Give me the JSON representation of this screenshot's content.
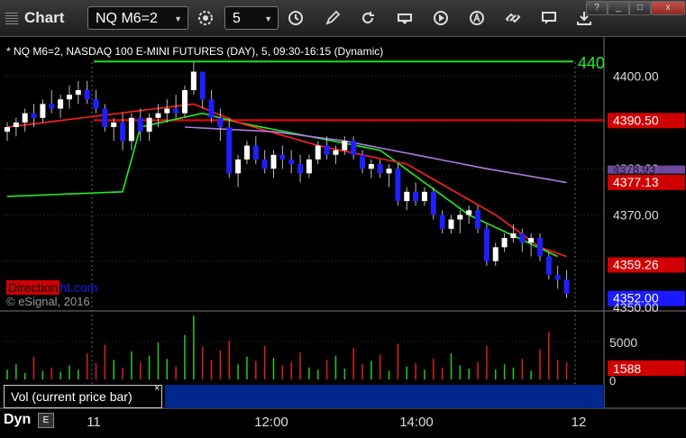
{
  "app": {
    "title": "Chart"
  },
  "toolbar": {
    "symbol": "NQ M6=2",
    "interval": "5",
    "icons": [
      "settings-icon",
      "clock-icon",
      "pencil-icon",
      "refresh-icon",
      "get-icon",
      "play-icon",
      "alert-icon",
      "link-icon",
      "chat-icon",
      "download-icon"
    ]
  },
  "window_buttons": [
    "?",
    "_",
    "□",
    "x"
  ],
  "header": {
    "subtitle": "* NQ M6=2, NASDAQ 100 E-MINI FUTURES (DAY), 5, 09:30-16:15 (Dynamic)"
  },
  "watermark": {
    "brand_red": "Direction",
    "brand_blue": "ht.com",
    "copyright": "© eSignal, 2016"
  },
  "volume_panel": {
    "label": "Vol (current price bar)",
    "close": "×"
  },
  "footer": {
    "dyn": "Dyn",
    "icon": "E"
  },
  "colors": {
    "up": "#ffffff",
    "down": "#1f1fff",
    "ma_green": "#22ee22",
    "ma_red": "#ff2020",
    "ma_purple": "#b07ae0",
    "level": "#ff0000",
    "hline_green": "#22dd22"
  },
  "chart_data": {
    "type": "candlestick",
    "price_axis": {
      "ticks": [
        "4400.00",
        "4390.50",
        "4380.00",
        "4377.13",
        "4370.00",
        "4359.26",
        "4352.00",
        "4350.00"
      ],
      "ylim": [
        4350,
        4405
      ]
    },
    "price_tags": [
      {
        "label": "4390.50",
        "color": "#d00000"
      },
      {
        "label": "4377.13",
        "color": "#d00000"
      },
      {
        "label": "4359.26",
        "color": "#d00000"
      },
      {
        "label": "4352.00",
        "color": "#1a1aff"
      },
      {
        "label": "4378.93",
        "color": "#7a50b0"
      }
    ],
    "partial_tag": "440",
    "levels": [
      4390.5,
      4403.2
    ],
    "volume_axis": {
      "ticks": [
        "5000",
        "0"
      ],
      "tag": "1588"
    },
    "x_labels": [
      "11",
      "12:00",
      "14:00",
      "12"
    ],
    "ohlc": [
      [
        4388,
        4390,
        4386,
        4389
      ],
      [
        4389,
        4391,
        4387,
        4390
      ],
      [
        4390,
        4393,
        4388,
        4392
      ],
      [
        4392,
        4394,
        4389,
        4391
      ],
      [
        4391,
        4395,
        4390,
        4394
      ],
      [
        4394,
        4397,
        4392,
        4393
      ],
      [
        4393,
        4396,
        4391,
        4395
      ],
      [
        4395,
        4398,
        4393,
        4396
      ],
      [
        4396,
        4399,
        4394,
        4397
      ],
      [
        4397,
        4399,
        4394,
        4395
      ],
      [
        4395,
        4397,
        4392,
        4393
      ],
      [
        4393,
        4394,
        4388,
        4389
      ],
      [
        4389,
        4391,
        4386,
        4390
      ],
      [
        4390,
        4392,
        4384,
        4386
      ],
      [
        4386,
        4392,
        4384,
        4391
      ],
      [
        4391,
        4393,
        4386,
        4388
      ],
      [
        4388,
        4392,
        4386,
        4391
      ],
      [
        4391,
        4394,
        4389,
        4392
      ],
      [
        4392,
        4395,
        4390,
        4393
      ],
      [
        4393,
        4396,
        4391,
        4392
      ],
      [
        4392,
        4398,
        4391,
        4397
      ],
      [
        4397,
        4403,
        4396,
        4401
      ],
      [
        4401,
        4400,
        4393,
        4395
      ],
      [
        4395,
        4397,
        4390,
        4391
      ],
      [
        4391,
        4393,
        4386,
        4389
      ],
      [
        4389,
        4391,
        4378,
        4379
      ],
      [
        4379,
        4383,
        4376,
        4382
      ],
      [
        4382,
        4386,
        4381,
        4385
      ],
      [
        4385,
        4387,
        4381,
        4382
      ],
      [
        4382,
        4384,
        4379,
        4380
      ],
      [
        4380,
        4384,
        4378,
        4383
      ],
      [
        4383,
        4385,
        4380,
        4382
      ],
      [
        4382,
        4384,
        4379,
        4381
      ],
      [
        4381,
        4383,
        4377,
        4379
      ],
      [
        4379,
        4383,
        4378,
        4382
      ],
      [
        4382,
        4386,
        4381,
        4385
      ],
      [
        4385,
        4387,
        4382,
        4383
      ],
      [
        4383,
        4385,
        4381,
        4384
      ],
      [
        4384,
        4387,
        4383,
        4386
      ],
      [
        4386,
        4387,
        4382,
        4383
      ],
      [
        4383,
        4384,
        4379,
        4380
      ],
      [
        4380,
        4382,
        4378,
        4381
      ],
      [
        4381,
        4382,
        4378,
        4379
      ],
      [
        4379,
        4381,
        4376,
        4380
      ],
      [
        4380,
        4381,
        4372,
        4373
      ],
      [
        4373,
        4376,
        4371,
        4375
      ],
      [
        4375,
        4377,
        4372,
        4373
      ],
      [
        4373,
        4376,
        4372,
        4375
      ],
      [
        4375,
        4376,
        4369,
        4370
      ],
      [
        4370,
        4371,
        4366,
        4367
      ],
      [
        4367,
        4370,
        4366,
        4369
      ],
      [
        4369,
        4371,
        4366,
        4370
      ],
      [
        4370,
        4372,
        4368,
        4371
      ],
      [
        4371,
        4372,
        4366,
        4367
      ],
      [
        4367,
        4368,
        4359,
        4360
      ],
      [
        4360,
        4364,
        4359,
        4363
      ],
      [
        4363,
        4366,
        4362,
        4365
      ],
      [
        4365,
        4368,
        4364,
        4366
      ],
      [
        4366,
        4367,
        4362,
        4364
      ],
      [
        4364,
        4366,
        4361,
        4365
      ],
      [
        4365,
        4366,
        4360,
        4361
      ],
      [
        4361,
        4362,
        4356,
        4357
      ],
      [
        4357,
        4359,
        4354,
        4356
      ],
      [
        4356,
        4358,
        4352,
        4353
      ]
    ],
    "volume": [
      900,
      1400,
      600,
      2100,
      800,
      1100,
      700,
      1300,
      900,
      2400,
      1500,
      3200,
      1800,
      1100,
      2600,
      1600,
      2200,
      3400,
      1900,
      1200,
      4100,
      5900,
      3000,
      1800,
      2700,
      3600,
      1400,
      2100,
      1700,
      3100,
      2000,
      1300,
      1600,
      2500,
      1100,
      900,
      1800,
      2200,
      1000,
      2900,
      1400,
      1700,
      2300,
      800,
      3300,
      1200,
      1500,
      900,
      1900,
      1100,
      2400,
      1300,
      1000,
      1600,
      3100,
      900,
      1400,
      1100,
      1900,
      800,
      2800,
      4400,
      1800,
      1588
    ],
    "series": [
      {
        "name": "",
        "color": "#22ee22",
        "anchors": [
          [
            0,
            4374
          ],
          [
            13,
            4375
          ],
          [
            15,
            4389
          ],
          [
            22,
            4392
          ],
          [
            26,
            4390
          ],
          [
            42,
            4384
          ],
          [
            52,
            4370
          ],
          [
            62,
            4361
          ]
        ]
      },
      {
        "name": "",
        "color": "#ff2020",
        "anchors": [
          [
            0,
            4389
          ],
          [
            21,
            4394
          ],
          [
            26,
            4390
          ],
          [
            35,
            4385
          ],
          [
            45,
            4381
          ],
          [
            55,
            4370
          ],
          [
            60,
            4363
          ],
          [
            63,
            4361
          ]
        ]
      },
      {
        "name": "",
        "color": "#b07ae0",
        "anchors": [
          [
            20,
            4389
          ],
          [
            30,
            4388
          ],
          [
            38,
            4386
          ],
          [
            46,
            4383
          ],
          [
            54,
            4380
          ],
          [
            60,
            4378
          ],
          [
            63,
            4377
          ]
        ]
      }
    ]
  }
}
